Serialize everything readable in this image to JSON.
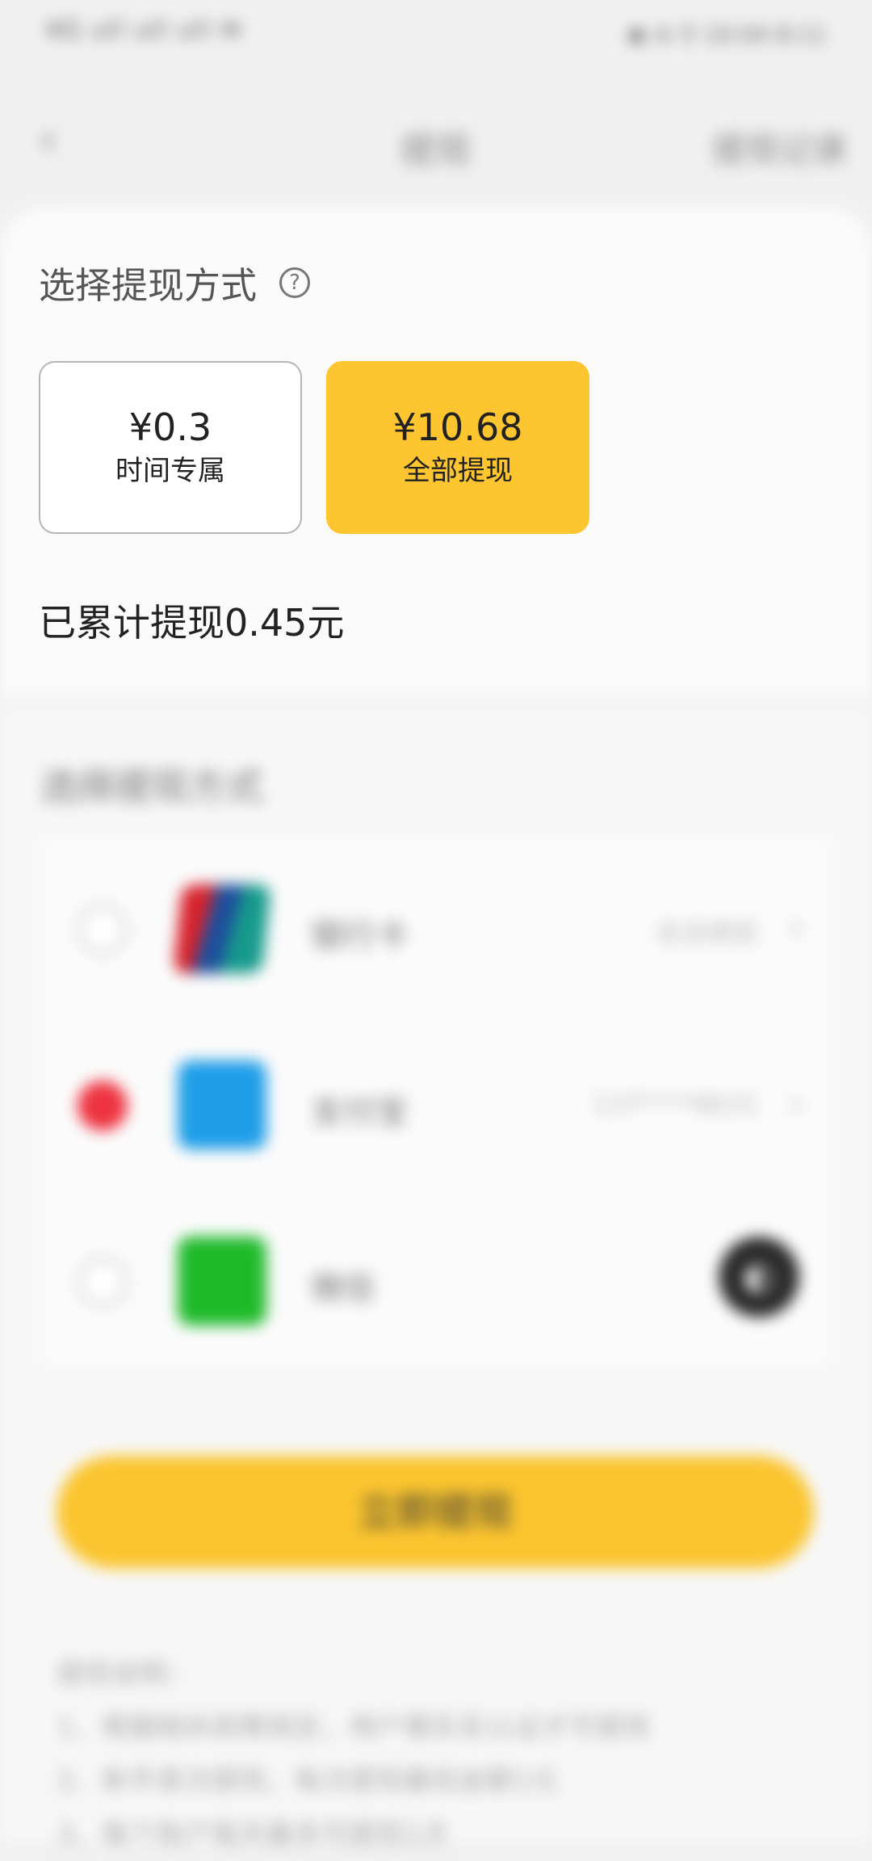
{
  "status_bar": {
    "left": "4G ull ull ull ✉",
    "right": "◉ ⊜ ⚲ 10:04 8:11"
  },
  "nav": {
    "back_icon": "chevron-left-icon",
    "title": "提现",
    "right_link": "提现记录"
  },
  "amount_section": {
    "title": "选择提现方式",
    "help_icon": "question-circle-icon",
    "help_glyph": "?",
    "options": [
      {
        "value": "¥0.3",
        "label": "时间专属",
        "selected": false
      },
      {
        "value": "¥10.68",
        "label": "全部提现",
        "selected": true
      }
    ],
    "cumulative": "已累计提现0.45元"
  },
  "method_section": {
    "title": "选择提现方式",
    "methods": [
      {
        "name": "银行卡",
        "icon": "unionpay-icon",
        "extra": "去去绑定",
        "selected": false
      },
      {
        "name": "支付宝",
        "icon": "alipay-icon",
        "extra": "137****6631",
        "selected": true
      },
      {
        "name": "微信",
        "icon": "wechat-icon",
        "extra": "",
        "selected": false
      }
    ]
  },
  "submit_button": "立即提现",
  "notes": {
    "title": "提现说明：",
    "lines": [
      "1、根据相关政策规定，用户需实名认证才可提现",
      "2、新手首次提现，每次提现最低金额1元",
      "3、每个账户每天最多可提现1次"
    ]
  },
  "colors": {
    "accent_yellow": "#fdc52f",
    "selected_red": "#ee3340",
    "background": "#f1f1f1"
  }
}
